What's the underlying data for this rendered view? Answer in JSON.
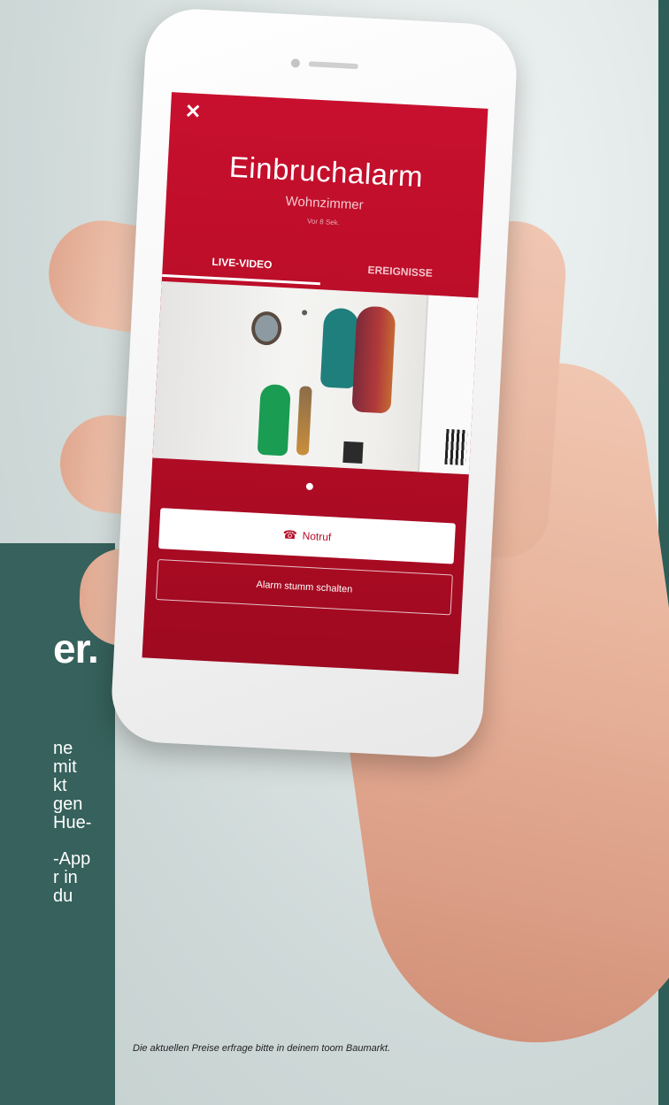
{
  "app": {
    "close_icon": "close-icon",
    "title": "Einbruchalarm",
    "room": "Wohnzimmer",
    "time_ago": "Vor 8 Sek.",
    "tabs": [
      {
        "label": "LIVE-VIDEO",
        "active": true
      },
      {
        "label": "EREIGNISSE",
        "active": false
      }
    ],
    "pager": {
      "current": 1,
      "total": 1
    },
    "call_button": {
      "icon": "phone-icon",
      "label": "Notruf"
    },
    "mute_button": {
      "label": "Alarm stumm schalten"
    },
    "accent_color": "#c8102e"
  },
  "side_panel": {
    "headline": "er.",
    "lines": [
      "ne",
      "mit",
      "kt",
      "gen",
      "Hue-",
      "",
      "-App",
      "r in",
      "du"
    ],
    "background": "#36615c"
  },
  "footnote": "Die aktuellen Preise erfrage bitte in deinem toom Baumarkt."
}
